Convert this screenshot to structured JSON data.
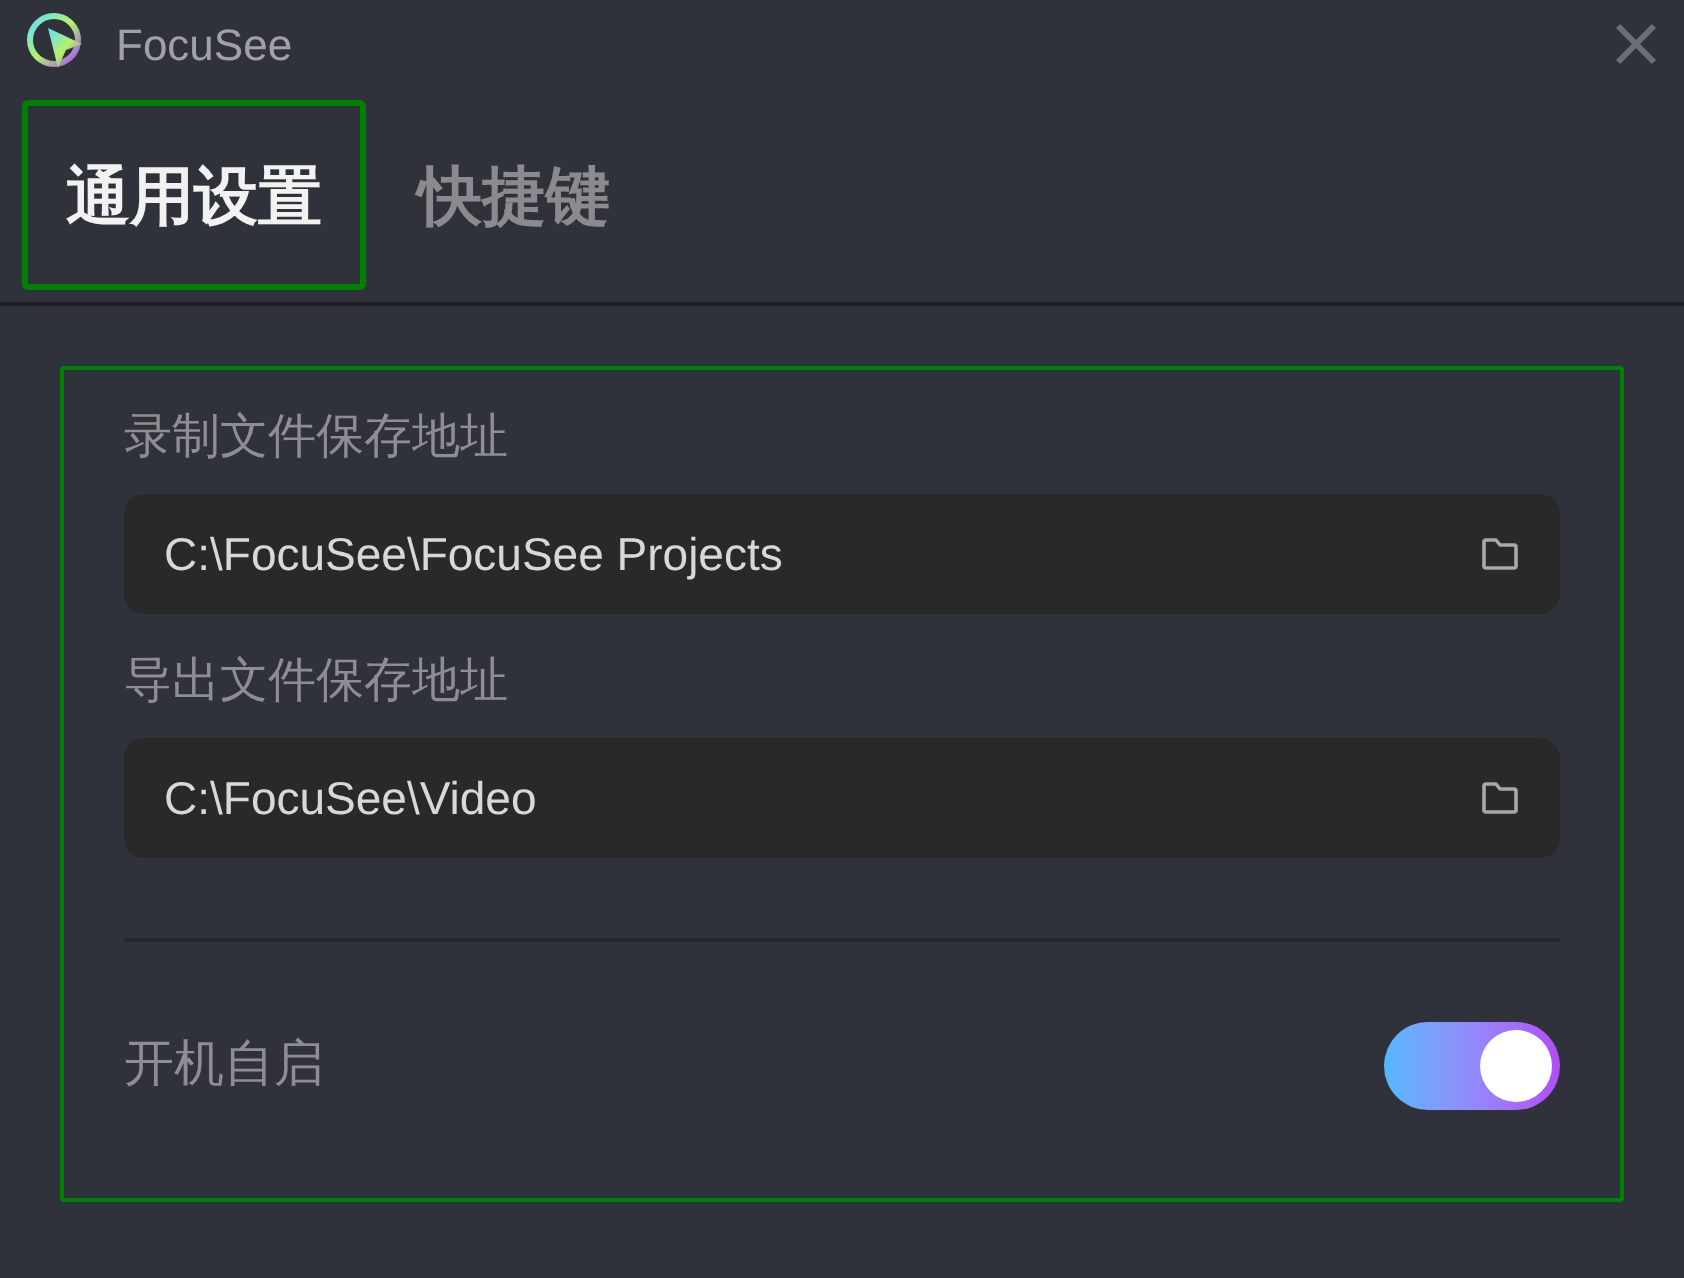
{
  "window": {
    "title": "FocuSee"
  },
  "tabs": [
    {
      "label": "通用设置",
      "selected": true
    },
    {
      "label": "快捷键",
      "selected": false
    }
  ],
  "paths": [
    {
      "label": "录制文件保存地址",
      "value": "C:\\FocuSee\\FocuSee Projects"
    },
    {
      "label": "导出文件保存地址",
      "value": "C:\\FocuSee\\Video"
    }
  ],
  "autostart": {
    "label": "开机自启",
    "on": true
  }
}
